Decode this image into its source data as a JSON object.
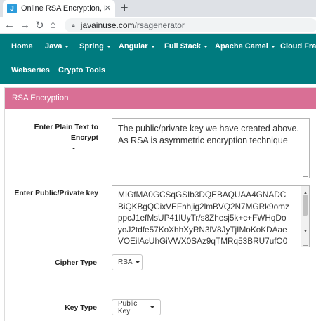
{
  "browser": {
    "tab_title": "Online RSA Encryption, Decryptio",
    "favicon_letter": "J",
    "url_domain": "javainuse.com",
    "url_path": "/rsagenerator"
  },
  "navbar": {
    "items": [
      {
        "label": "Home"
      },
      {
        "label": "Java"
      },
      {
        "label": "Spring"
      },
      {
        "label": "Angular"
      },
      {
        "label": "Full Stack"
      },
      {
        "label": "Apache Camel"
      },
      {
        "label": "Cloud Fram"
      },
      {
        "label": "Webseries"
      },
      {
        "label": "Crypto Tools"
      }
    ],
    "color": "#007b7f"
  },
  "panel": {
    "title": "RSA Encryption",
    "heading_color": "#d96f95"
  },
  "form": {
    "plain_text_label": "Enter Plain Text to Encrypt",
    "plain_text_value": "The public/private key we have created above. As RSA is asymmetric encryption technique",
    "key_label": "Enter Public/Private key",
    "key_lines": [
      "MIGfMA0GCSqGSIb3DQEBAQUAA4GNADC",
      "BiQKBgQCixVEFhhjig2lmBVQ2N7MGRk9omz",
      "ppcJ1efMsUP41lUyTr/s8Zhesj5k+c+FWHqDo",
      "yoJ2tdfe57KoXhhXyRN3lV8JyTjIMoKoKDAae",
      "VOEilAcUhGiVWX0SAz9qTMRq53BRU7ufO0"
    ],
    "cipher_type_label": "Cipher Type",
    "cipher_type_value": "RSA",
    "key_type_label": "Key Type",
    "key_type_value": "Public Key"
  }
}
